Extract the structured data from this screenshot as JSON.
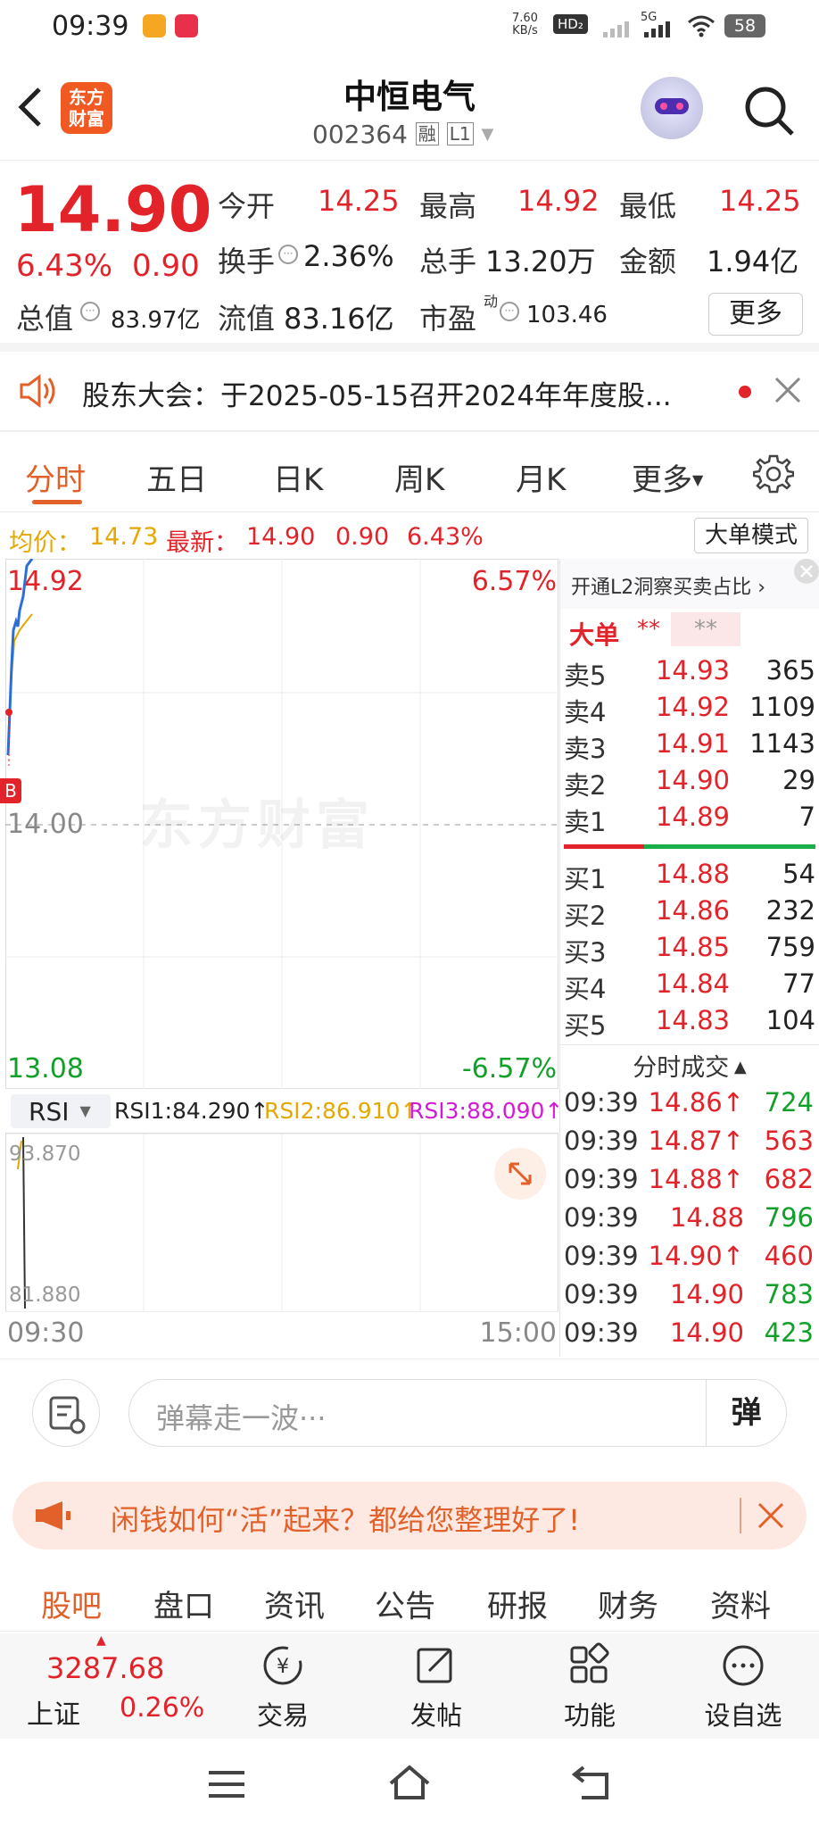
{
  "status": {
    "time": "09:39",
    "net_speed_top": "7.60",
    "net_speed_bottom": "KB/s",
    "hd": "HD₂",
    "net": "5G",
    "battery": "58"
  },
  "header": {
    "brand_line1": "东方",
    "brand_line2": "财富",
    "stock_name": "中恒电气",
    "stock_code": "002364",
    "rong_badge": "融",
    "level_badge": "L1"
  },
  "quote": {
    "price": "14.90",
    "change_pct": "6.43%",
    "change_amt": "0.90",
    "open_label": "今开",
    "open": "14.25",
    "high_label": "最高",
    "high": "14.92",
    "low_label": "最低",
    "low": "14.25",
    "turnover_label": "换手",
    "turnover": "2.36%",
    "volume_label": "总手",
    "volume": "13.20万",
    "amount_label": "金额",
    "amount": "1.94亿",
    "mcap_label": "总值",
    "mcap": "83.97亿",
    "float_label": "流值",
    "float_mcap": "83.16亿",
    "pe_label": "市盈",
    "pe_sup": "动",
    "pe": "103.46",
    "more": "更多"
  },
  "notice": {
    "text": "股东大会：于2025-05-15召开2024年年度股..."
  },
  "tabs": [
    "分时",
    "五日",
    "日K",
    "周K",
    "月K",
    "更多"
  ],
  "infoline": {
    "avg_label": "均价：",
    "avg": "14.73",
    "latest_label": "最新：",
    "latest": "14.90",
    "chg": "0.90",
    "pct": "6.43%",
    "mode": "大单模式"
  },
  "chart": {
    "y_max": "14.92",
    "y_mid": "14.00",
    "y_min": "13.08",
    "pct_max": "6.57%",
    "pct_min": "-6.57%",
    "b_marker": "B",
    "watermark": "东方财富",
    "rsi_name": "RSI",
    "rsi1": "RSI1:84.290↑",
    "rsi2": "RSI2:86.910↑",
    "rsi3": "RSI3:88.090↑",
    "rsi_max": "93.870",
    "rsi_min": "81.880",
    "t_start": "09:30",
    "t_end": "15:00"
  },
  "orderbook": {
    "promo": "开通L2洞察买卖占比 ›",
    "big_label": "大单",
    "big_v1": "**",
    "big_v2": "**",
    "asks": [
      {
        "label": "卖5",
        "price": "14.93",
        "vol": "365"
      },
      {
        "label": "卖4",
        "price": "14.92",
        "vol": "1109"
      },
      {
        "label": "卖3",
        "price": "14.91",
        "vol": "1143"
      },
      {
        "label": "卖2",
        "price": "14.90",
        "vol": "29"
      },
      {
        "label": "卖1",
        "price": "14.89",
        "vol": "7"
      }
    ],
    "bids": [
      {
        "label": "买1",
        "price": "14.88",
        "vol": "54"
      },
      {
        "label": "买2",
        "price": "14.86",
        "vol": "232"
      },
      {
        "label": "买3",
        "price": "14.85",
        "vol": "759"
      },
      {
        "label": "买4",
        "price": "14.84",
        "vol": "77"
      },
      {
        "label": "买5",
        "price": "14.83",
        "vol": "104"
      }
    ]
  },
  "trades": {
    "title": "分时成交",
    "rows": [
      {
        "time": "09:39",
        "price": "14.86↑",
        "vol": "724",
        "vc": "green"
      },
      {
        "time": "09:39",
        "price": "14.87↑",
        "vol": "563",
        "vc": "red"
      },
      {
        "time": "09:39",
        "price": "14.88↑",
        "vol": "682",
        "vc": "red"
      },
      {
        "time": "09:39",
        "price": "14.88",
        "vol": "796",
        "vc": "green"
      },
      {
        "time": "09:39",
        "price": "14.90↑",
        "vol": "460",
        "vc": "red"
      },
      {
        "time": "09:39",
        "price": "14.90",
        "vol": "783",
        "vc": "green"
      },
      {
        "time": "09:39",
        "price": "14.90",
        "vol": "423",
        "vc": "green"
      }
    ]
  },
  "comment": {
    "placeholder": "弹幕走一波···",
    "danmu_icon": "弹"
  },
  "ad": {
    "text": "闲钱如何“活”起来？都给您整理好了!"
  },
  "bottom_tabs": [
    "股吧",
    "盘口",
    "资讯",
    "公告",
    "研报",
    "财务",
    "资料"
  ],
  "dock": {
    "index_value": "3287.68",
    "index_name": "上证",
    "index_pct": "0.26%",
    "items": [
      "交易",
      "发帖",
      "功能",
      "设自选"
    ]
  },
  "colors": {
    "up": "#e2232a",
    "down": "#12a02a",
    "accent": "#e2612a",
    "avg_line": "#e4a800",
    "price_line": "#2b6fd6"
  }
}
